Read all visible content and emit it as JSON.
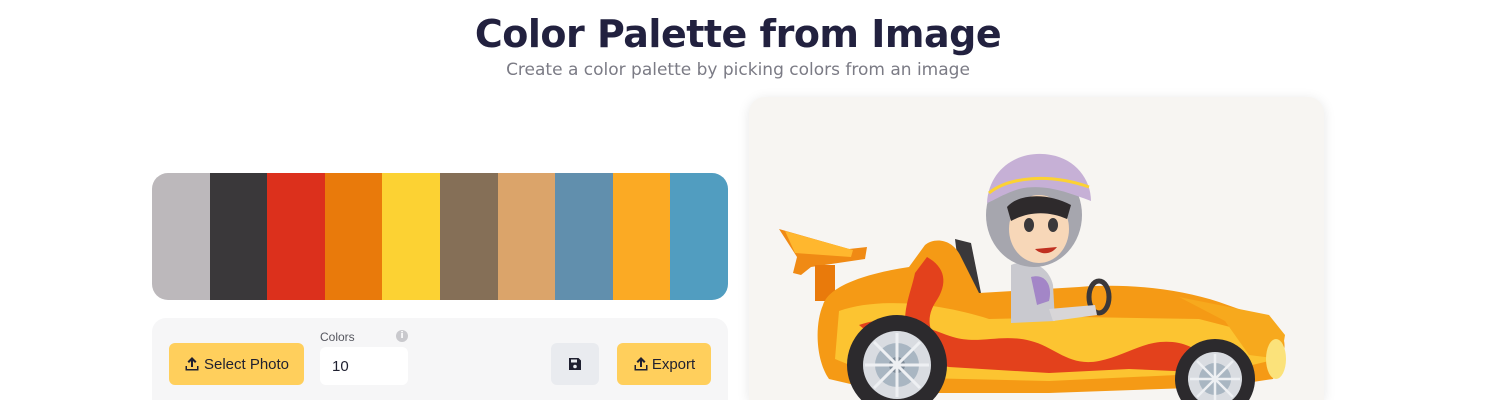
{
  "header": {
    "title": "Color Palette from Image",
    "subtitle": "Create a color palette by picking colors from an image"
  },
  "palette": {
    "swatches": [
      {
        "color": "#bcb8bb"
      },
      {
        "color": "#3a383a"
      },
      {
        "color": "#dc301c"
      },
      {
        "color": "#e97a0b"
      },
      {
        "color": "#fcd233"
      },
      {
        "color": "#856f57"
      },
      {
        "color": "#dba46a"
      },
      {
        "color": "#618fad"
      },
      {
        "color": "#fbaa24"
      },
      {
        "color": "#519dc0"
      }
    ]
  },
  "controls": {
    "select_photo_label": "Select Photo",
    "upload_icon": "upload-icon",
    "colors_label": "Colors",
    "colors_value": "10",
    "info_icon": "info-icon",
    "save_icon": "floppy-disk-icon",
    "export_label": "Export",
    "export_icon": "export-icon",
    "accent_color": "#ffcf5c"
  },
  "image": {
    "subject": "cartoon-go-kart-driver"
  }
}
